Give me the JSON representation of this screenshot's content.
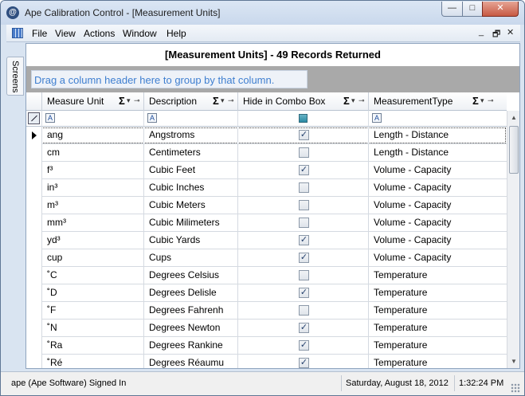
{
  "window": {
    "title": "Ape Calibration Control - [Measurement Units]",
    "app_icon": "ape-logo-icon",
    "controls": {
      "minimize": "—",
      "maximize": "□",
      "close": "✕"
    }
  },
  "menubar": {
    "items": [
      "File",
      "View",
      "Actions",
      "Window",
      "Help"
    ],
    "mdi_controls": {
      "minimize": "_",
      "restore": "🗗",
      "close": "✕"
    }
  },
  "side_tab": {
    "label": "Screens"
  },
  "grid": {
    "caption": "[Measurement Units] - 49 Records Returned",
    "group_hint": "Drag a column header here to group by that column.",
    "columns": [
      {
        "label": "Measure Unit"
      },
      {
        "label": "Description"
      },
      {
        "label": "Hide in Combo Box"
      },
      {
        "label": "MeasurementType"
      }
    ],
    "sigma": "Σ",
    "dropdown": "▾",
    "pin": "⊸",
    "filter_letter": "A",
    "check": "✓",
    "rows": [
      {
        "unit": "ang",
        "description": "Angstroms",
        "hide": true,
        "type": "Length - Distance",
        "current": true
      },
      {
        "unit": "cm",
        "description": "Centimeters",
        "hide": false,
        "type": "Length - Distance"
      },
      {
        "unit": "f³",
        "description": "Cubic Feet",
        "hide": true,
        "type": "Volume - Capacity"
      },
      {
        "unit": "in³",
        "description": "Cubic Inches",
        "hide": false,
        "type": "Volume - Capacity"
      },
      {
        "unit": "m³",
        "description": "Cubic Meters",
        "hide": false,
        "type": "Volume - Capacity"
      },
      {
        "unit": "mm³",
        "description": "Cubic Milimeters",
        "hide": false,
        "type": "Volume - Capacity"
      },
      {
        "unit": "yd³",
        "description": "Cubic Yards",
        "hide": true,
        "type": "Volume - Capacity"
      },
      {
        "unit": "cup",
        "description": "Cups",
        "hide": true,
        "type": "Volume - Capacity"
      },
      {
        "unit": "˚C",
        "description": "Degrees Celsius",
        "hide": false,
        "type": "Temperature"
      },
      {
        "unit": "˚D",
        "description": "Degrees Delisle",
        "hide": true,
        "type": "Temperature"
      },
      {
        "unit": "˚F",
        "description": "Degrees Fahrenh",
        "hide": false,
        "type": "Temperature"
      },
      {
        "unit": "˚N",
        "description": "Degrees Newton",
        "hide": true,
        "type": "Temperature"
      },
      {
        "unit": "˚Ra",
        "description": "Degrees Rankine",
        "hide": true,
        "type": "Temperature"
      },
      {
        "unit": "˚Ré",
        "description": "Degrees Réaumu",
        "hide": true,
        "type": "Temperature"
      }
    ]
  },
  "statusbar": {
    "user": "ape (Ape Software) Signed In",
    "date": "Saturday, August 18, 2012",
    "time": "1:32:24 PM"
  }
}
